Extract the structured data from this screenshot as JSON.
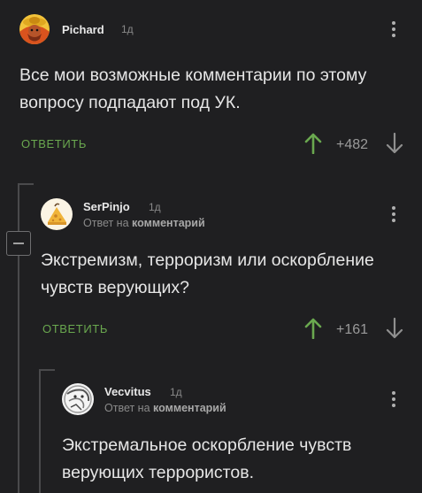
{
  "comments": [
    {
      "username": "Pichard",
      "time": "1д",
      "text_lines": [
        "Все мои возможные комментарии  по этому",
        "вопросу подпадают под УК."
      ],
      "reply_label": "ОТВЕТИТЬ",
      "rating": "+482"
    },
    {
      "username": "SerPinjo",
      "time": "1д",
      "reply_prefix": "Ответ на",
      "reply_target": "комментарий",
      "text_lines": [
        "Экстремизм, терроризм или оскорбление",
        "чувств верующих?"
      ],
      "reply_label": "ОТВЕТИТЬ",
      "rating": "+161"
    },
    {
      "username": "Vecvitus",
      "time": "1д",
      "reply_prefix": "Ответ на",
      "reply_target": "комментарий",
      "text_lines": [
        "Экстремальное оскорбление чувств",
        "верующих террористов."
      ]
    }
  ],
  "colors": {
    "background": "#1f1f21",
    "accent_green": "#6aa84f",
    "text": "#e6e6e6",
    "muted": "#8a8a8a"
  },
  "icons": [
    "kebab-menu-icon",
    "arrow-up-icon",
    "arrow-down-icon",
    "collapse-minus-icon"
  ]
}
